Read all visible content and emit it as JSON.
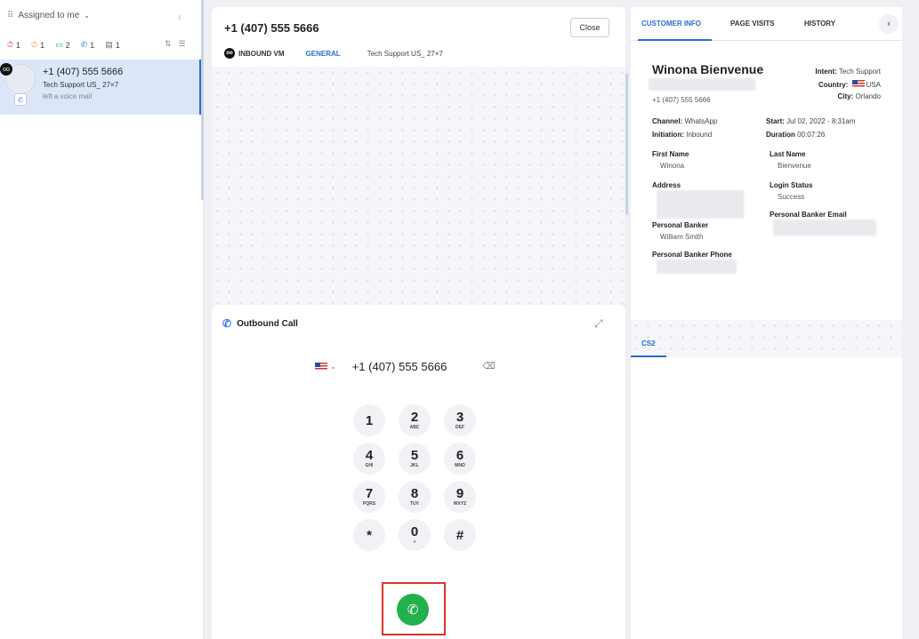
{
  "sidebar": {
    "assigned_label": "Assigned to me",
    "filters": [
      {
        "icon": "missed-icon",
        "count": "1",
        "color": "#e0443a"
      },
      {
        "icon": "pending-icon",
        "count": "1",
        "color": "#e99a2b"
      },
      {
        "icon": "chat-icon",
        "count": "2",
        "color": "#2fa84f"
      },
      {
        "icon": "phone-icon",
        "count": "1",
        "color": "#3a7be0"
      },
      {
        "icon": "message-icon",
        "count": "1",
        "color": "#666666"
      }
    ],
    "conversation": {
      "phone": "+1 (407) 555 5666",
      "queue": "Tech Support US_ 27×7",
      "last_message": "left a voice mail"
    }
  },
  "interaction": {
    "phone": "+1 (407) 555 5666",
    "close_label": "Close",
    "type_label": "INBOUND VM",
    "category_label": "GENERAL",
    "queue_label": "Tech Support US_ 27×7"
  },
  "dialer": {
    "title": "Outbound Call",
    "number": "+1 (407) 555 5666",
    "keys": [
      {
        "digit": "1",
        "letters": ""
      },
      {
        "digit": "2",
        "letters": "ABC"
      },
      {
        "digit": "3",
        "letters": "DEF"
      },
      {
        "digit": "4",
        "letters": "GHI"
      },
      {
        "digit": "5",
        "letters": "JKL"
      },
      {
        "digit": "6",
        "letters": "MNO"
      },
      {
        "digit": "7",
        "letters": "PQRS"
      },
      {
        "digit": "8",
        "letters": "TUV"
      },
      {
        "digit": "9",
        "letters": "WXYZ"
      },
      {
        "digit": "*",
        "letters": ""
      },
      {
        "digit": "0",
        "letters": "+"
      },
      {
        "digit": "#",
        "letters": ""
      }
    ]
  },
  "customer": {
    "tabs": [
      "CUSTOMER INFO",
      "PAGE VISITS",
      "HISTORY"
    ],
    "name": "Winona Bienvenue",
    "phone": "+1 (407) 555 5666",
    "intent_label": "Intent:",
    "intent": "Tech Support",
    "country_label": "Country:",
    "country": "USA",
    "city_label": "City:",
    "city": "Orlando",
    "channel_label": "Channel:",
    "channel": "WhatsApp",
    "initiation_label": "Initiation:",
    "initiation": "Inbound",
    "start_label": "Start:",
    "start": "Jul 02, 2022 - 8:31am",
    "duration_label": "Duration",
    "duration": "00:07:26",
    "first_name_label": "First Name",
    "first_name": "Winona",
    "last_name_label": "Last Name",
    "last_name": "Bienvenue",
    "address_label": "Address",
    "login_status_label": "Login Status",
    "login_status": "Success",
    "banker_email_label": "Personal Banker Email",
    "banker_label": "Personal Banker",
    "banker": "William Smith",
    "banker_phone_label": "Personal Banker Phone",
    "cs2_tab": "CS2"
  }
}
